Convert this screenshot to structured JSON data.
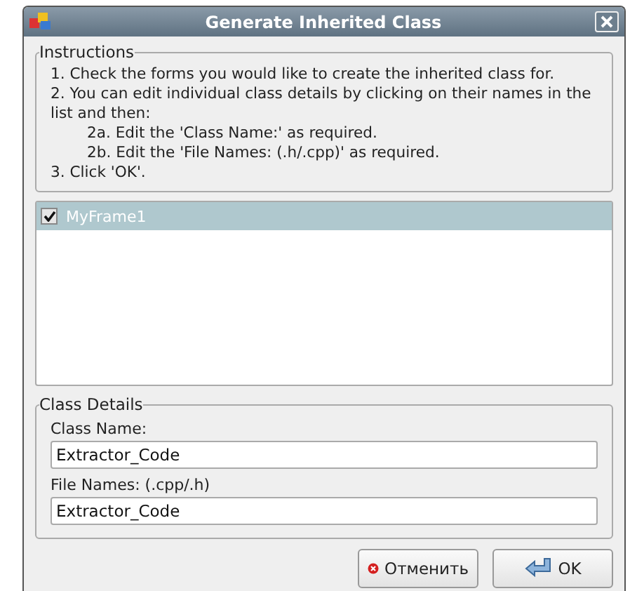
{
  "window": {
    "title": "Generate Inherited Class"
  },
  "instructions": {
    "legend": "Instructions",
    "lines": [
      {
        "text": "1. Check the forms you would like to create the inherited class for.",
        "indented": false
      },
      {
        "text": "2. You can edit individual class details by clicking on their names in the list and then:",
        "indented": false
      },
      {
        "text": "2a. Edit the 'Class Name:' as required.",
        "indented": true
      },
      {
        "text": "2b. Edit the 'File Names: (.h/.cpp)' as required.",
        "indented": true
      },
      {
        "text": "3. Click 'OK'.",
        "indented": false
      }
    ]
  },
  "forms": [
    {
      "name": "MyFrame1",
      "checked": true,
      "selected": true
    }
  ],
  "class_details": {
    "legend": "Class Details",
    "class_name": {
      "label": "Class Name:",
      "value": "Extractor_Code"
    },
    "file_names": {
      "label": "File Names: (.cpp/.h)",
      "value": "Extractor_Code"
    }
  },
  "buttons": [
    {
      "kind": "cancel",
      "label": "Отменить"
    },
    {
      "kind": "ok",
      "label": "OK"
    }
  ]
}
